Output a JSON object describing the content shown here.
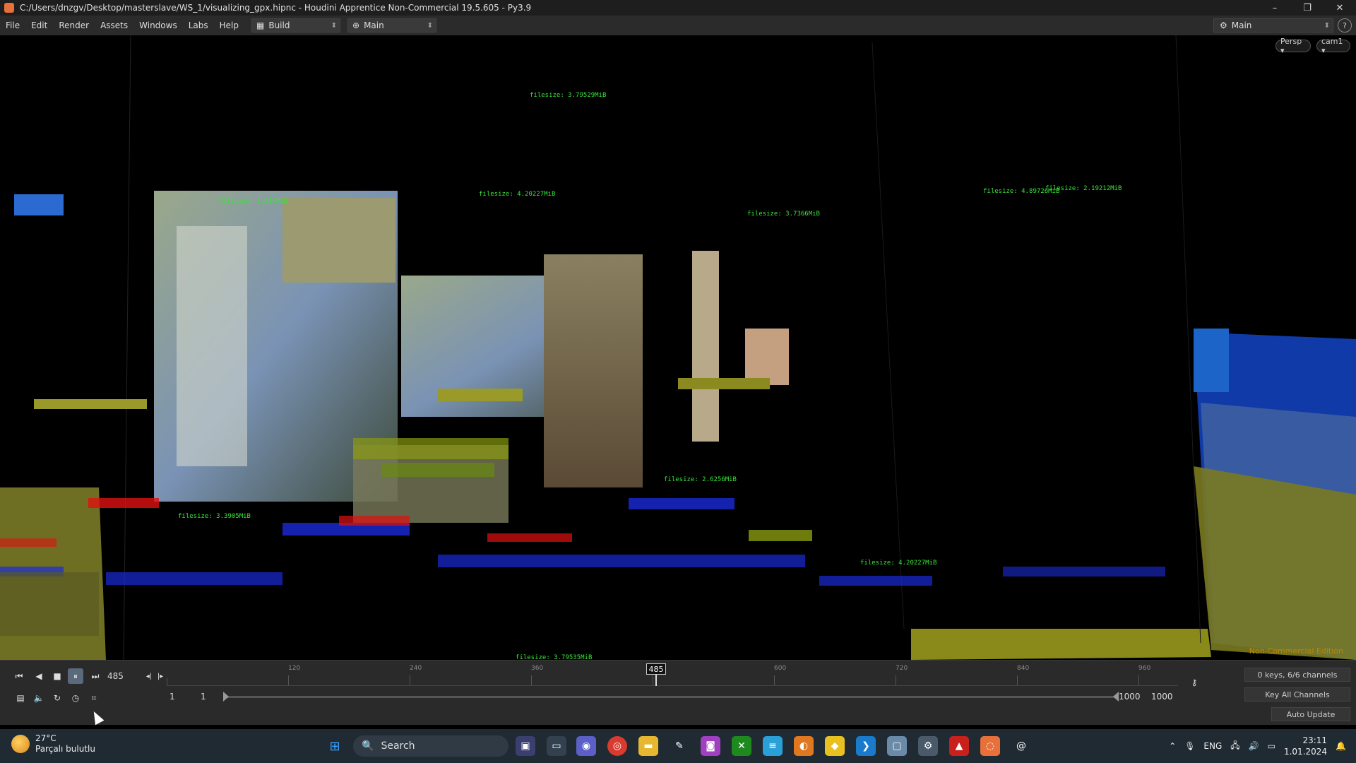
{
  "window": {
    "title": "C:/Users/dnzgv/Desktop/masterslave/WS_1/visualizing_gpx.hipnc - Houdini Apprentice Non-Commercial 19.5.605 - Py3.9",
    "minimize": "–",
    "maximize": "❐",
    "close": "✕"
  },
  "menu": {
    "items": [
      "File",
      "Edit",
      "Render",
      "Assets",
      "Windows",
      "Labs",
      "Help"
    ],
    "desktop": "Build",
    "network": "Main",
    "right_desktop": "Main",
    "help_glyph": "?"
  },
  "viewport": {
    "camera_persp": "Persp ▾",
    "camera_cam": "cam1 ▾",
    "watermark": "Non-Commercial Edition",
    "overlay_labels": [
      {
        "text": "filesize: 3.79529MiB"
      },
      {
        "text": "filesize: 4.20227MiB"
      },
      {
        "text": "filesize: 2.81GMiB"
      },
      {
        "text": "filesize: 3.7366MiB"
      },
      {
        "text": "filesize: 2.19212MiB"
      },
      {
        "text": "filesize: 4.89726MiB"
      },
      {
        "text": "filesize: 3.3905MiB"
      },
      {
        "text": "filesize: 2.6256MiB"
      },
      {
        "text": "filesize: 4.20227MiB"
      },
      {
        "text": "filesize: 3.79535MiB"
      }
    ]
  },
  "timeline": {
    "current_frame": "485",
    "marker_frame": "485",
    "range_start_a": "1",
    "range_start_b": "1",
    "range_end_a": "1000",
    "range_end_b": "1000",
    "keys_info": "0 keys, 6/6 channels",
    "key_all": "Key All Channels",
    "auto_update": "Auto Update",
    "ruler_labels": [
      "120",
      "240",
      "360",
      "600",
      "720",
      "840",
      "960"
    ]
  },
  "taskbar": {
    "weather_temp": "27°C",
    "weather_desc": "Parçalı bulutlu",
    "search": "Search",
    "lang": "ENG",
    "time": "23:11",
    "date": "1.01.2024"
  },
  "colors": {
    "accent": "#e8703a",
    "label_green": "#39e639",
    "label_red": "#e01010",
    "label_blue": "#1a2bd8",
    "ground_yellow": "#8a8a1a"
  }
}
